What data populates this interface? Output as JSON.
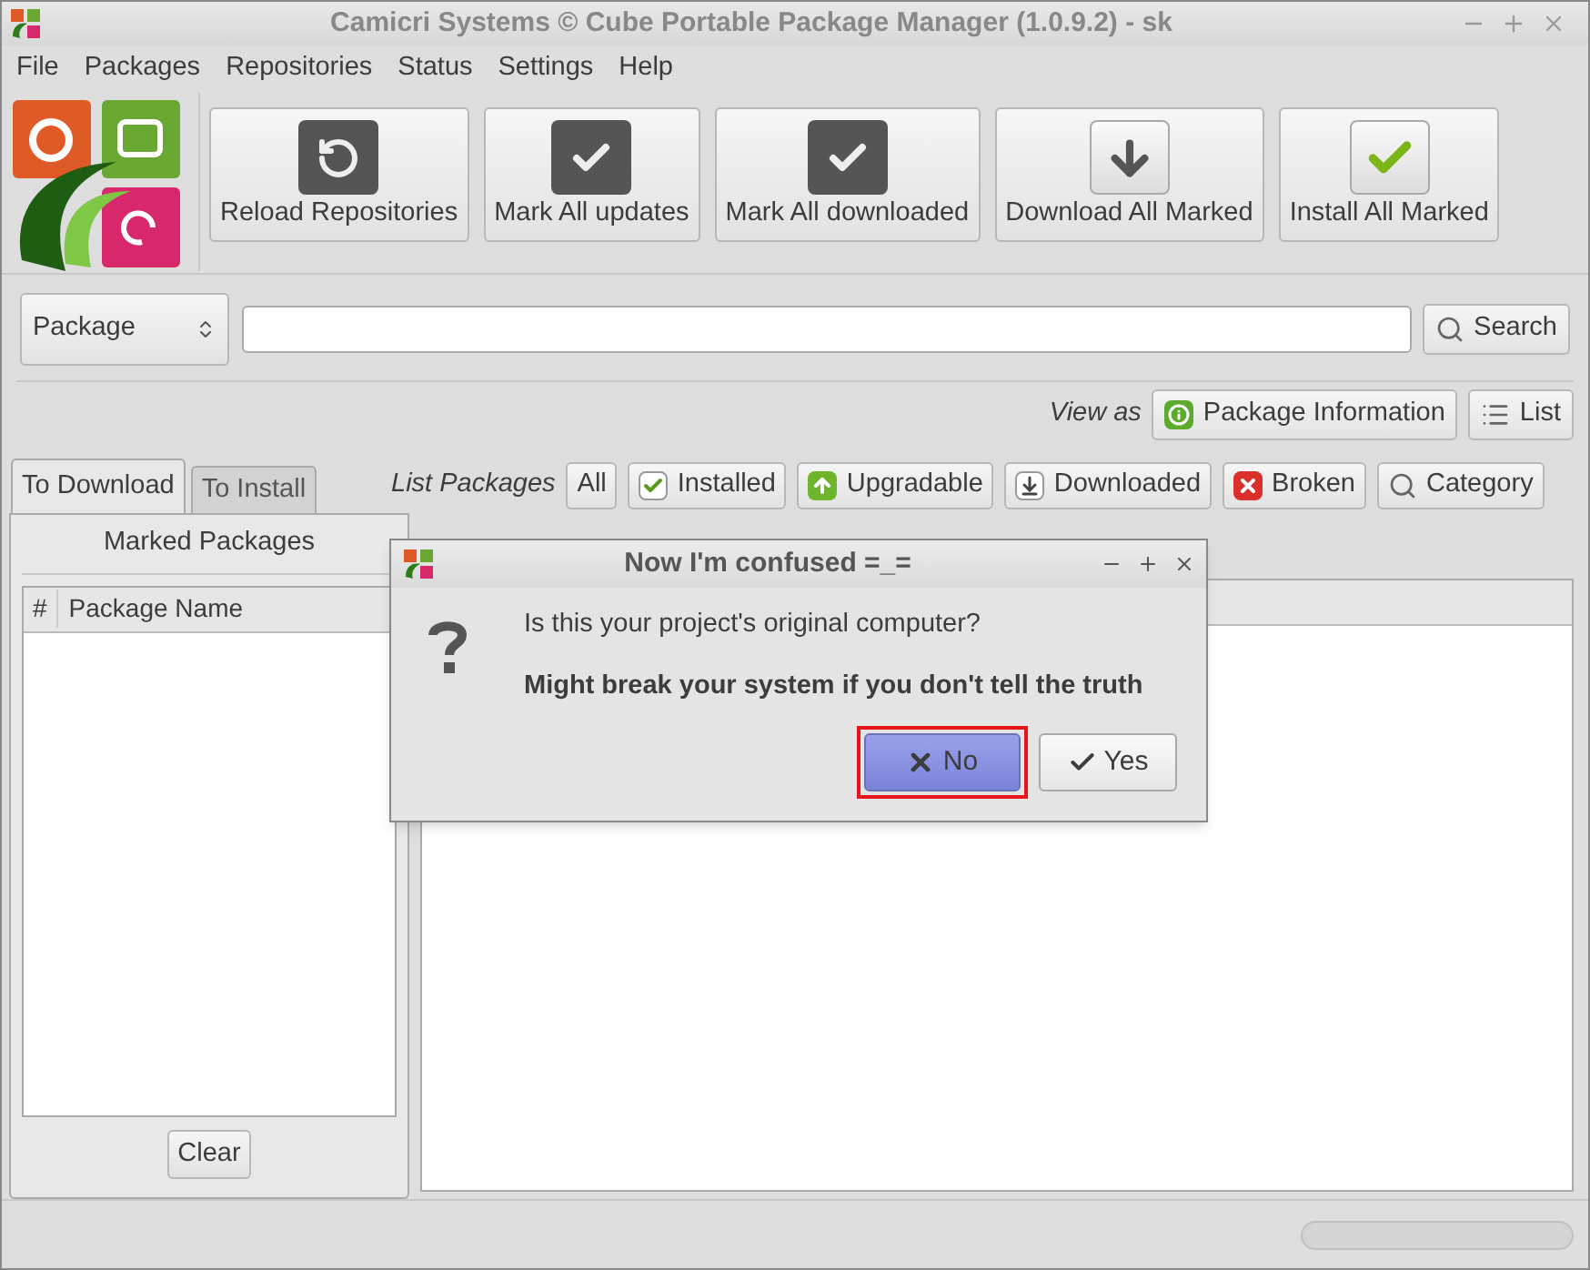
{
  "window": {
    "title": "Camicri Systems © Cube Portable Package Manager (1.0.9.2) - sk"
  },
  "menu": [
    "File",
    "Packages",
    "Repositories",
    "Status",
    "Settings",
    "Help"
  ],
  "toolbar": [
    {
      "label": "Reload Repositories",
      "kind": "reload"
    },
    {
      "label": "Mark All updates",
      "kind": "check"
    },
    {
      "label": "Mark All downloaded",
      "kind": "check"
    },
    {
      "label": "Download All Marked",
      "kind": "download"
    },
    {
      "label": "Install All Marked",
      "kind": "install"
    }
  ],
  "search": {
    "scope": "Package",
    "button": "Search"
  },
  "view_as": {
    "label": "View as",
    "buttons": [
      {
        "label": "Package Information",
        "kind": "info"
      },
      {
        "label": "List",
        "kind": "list"
      }
    ]
  },
  "tabs": [
    {
      "label": "To Download",
      "selected": true
    },
    {
      "label": "To Install",
      "selected": false
    }
  ],
  "marked": {
    "title": "Marked Packages",
    "columns": [
      "#",
      "Package Name"
    ],
    "clear": "Clear"
  },
  "list_packages": {
    "label": "List Packages",
    "filters": [
      {
        "label": "All",
        "kind": "plain"
      },
      {
        "label": "Installed",
        "kind": "installed"
      },
      {
        "label": "Upgradable",
        "kind": "upgradable"
      },
      {
        "label": "Downloaded",
        "kind": "downloaded"
      },
      {
        "label": "Broken",
        "kind": "broken"
      },
      {
        "label": "Category",
        "kind": "search"
      }
    ]
  },
  "progress": {
    "level": 0
  },
  "dialog": {
    "title": "Now I'm confused =_=",
    "message": "Is this your project's original computer?",
    "detail": "Might break your system if you don't tell the truth",
    "buttons": [
      {
        "label": "No",
        "kind": "no",
        "focused": true
      },
      {
        "label": "Yes",
        "kind": "yes",
        "focused": false
      }
    ]
  }
}
